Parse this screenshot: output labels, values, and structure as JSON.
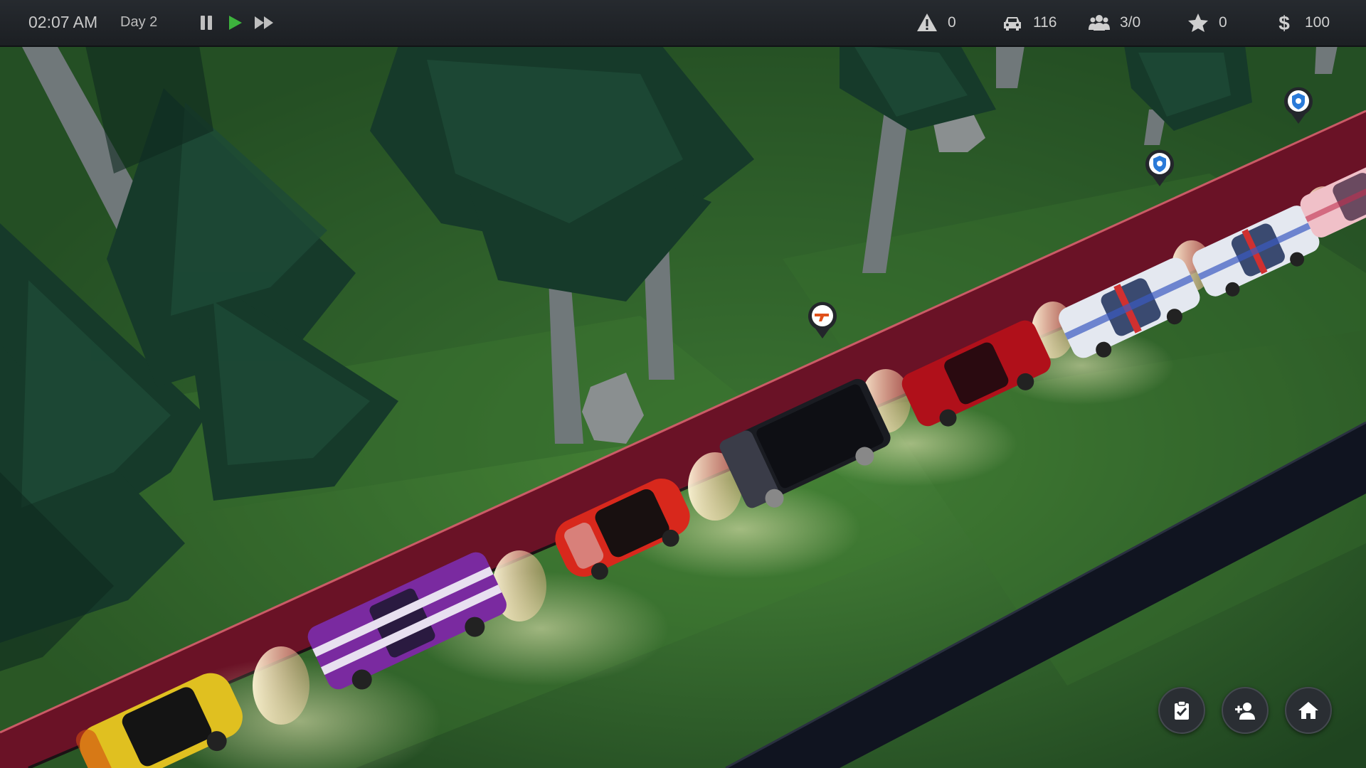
{
  "hud": {
    "time": "02:07 AM",
    "day": "Day 2",
    "controls": {
      "pause_icon": "pause-icon",
      "play_icon": "play-icon",
      "fast_forward_icon": "fast-forward-icon",
      "active_color": "#3db33d"
    },
    "stats": [
      {
        "name": "alerts",
        "icon": "warning-icon",
        "value": "0"
      },
      {
        "name": "cars",
        "icon": "car-icon",
        "value": "116"
      },
      {
        "name": "staff",
        "icon": "people-icon",
        "value": "3/0"
      },
      {
        "name": "rating",
        "icon": "star-icon",
        "value": "0"
      },
      {
        "name": "money",
        "icon": "dollar-icon",
        "value": "100"
      }
    ]
  },
  "scene": {
    "road_color": "#6a1226",
    "road_border_color": "#c94a5c",
    "vehicles": [
      {
        "type": "hatchback",
        "color": "#e0c020"
      },
      {
        "type": "muscle-car",
        "color": "#7a2aa0"
      },
      {
        "type": "hatchback",
        "color": "#d8281c"
      },
      {
        "type": "van",
        "color": "#1a1c22"
      },
      {
        "type": "sedan",
        "color": "#b0101a"
      },
      {
        "type": "police-car",
        "color": "#e4e8f0"
      },
      {
        "type": "police-car",
        "color": "#e4e8f0"
      },
      {
        "type": "police-car",
        "color": "#f0c0c8"
      }
    ],
    "markers": [
      {
        "icon": "gun-icon",
        "kind": "suspicious"
      },
      {
        "icon": "police-badge-icon",
        "kind": "police"
      },
      {
        "icon": "police-badge-icon",
        "kind": "police"
      }
    ]
  },
  "buttons": [
    {
      "name": "tasks-button",
      "icon": "clipboard-check-icon"
    },
    {
      "name": "hire-staff-button",
      "icon": "add-person-icon"
    },
    {
      "name": "home-button",
      "icon": "home-icon"
    }
  ]
}
